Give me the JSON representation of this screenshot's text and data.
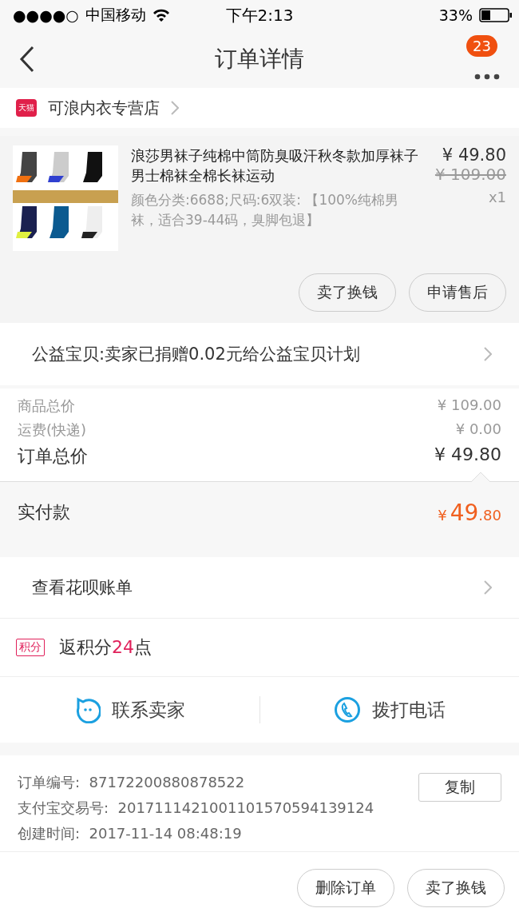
{
  "status_bar": {
    "signal_dots": "●●●●○",
    "carrier": "中国移动",
    "time": "下午2:13",
    "battery": "33%"
  },
  "nav": {
    "title": "订单详情",
    "badge": "23"
  },
  "shop": {
    "badge": "天猫",
    "name": "可浪内衣专营店"
  },
  "product": {
    "title": "浪莎男袜子纯棉中筒防臭吸汗秋冬款加厚袜子男士棉袜全棉长袜运动",
    "spec": "颜色分类:6688;尺码:6双装: 【100%纯棉男袜，适合39-44码，臭脚包退】",
    "price": "¥ 49.80",
    "original_price": "¥ 109.00",
    "quantity": "x1"
  },
  "product_buttons": [
    "卖了换钱",
    "申请售后"
  ],
  "charity": "公益宝贝:卖家已捐赠0.02元给公益宝贝计划",
  "totals": [
    {
      "label": "商品总价",
      "value": "¥ 109.00",
      "kind": "minor"
    },
    {
      "label": "运费(快递)",
      "value": "¥ 0.00",
      "kind": "minor"
    },
    {
      "label": "订单总价",
      "value": "¥ 49.80",
      "kind": "major"
    }
  ],
  "paid": {
    "label": "实付款",
    "currency": "¥",
    "integer": "49",
    "decimal": ".80"
  },
  "huabei": "查看花呗账单",
  "points": {
    "badge": "积分",
    "prefix": "返积分",
    "amount": "24",
    "suffix": "点"
  },
  "contact": [
    "联系卖家",
    "拨打电话"
  ],
  "info": [
    {
      "label": "订单编号:",
      "value": "87172200880878522"
    },
    {
      "label": "支付宝交易号:",
      "value": "2017111421001101570594139124"
    },
    {
      "label": "创建时间:",
      "value": "2017-11-14 08:48:19"
    }
  ],
  "copy_button": "复制",
  "footer_buttons": [
    "删除订单",
    "卖了换钱"
  ]
}
